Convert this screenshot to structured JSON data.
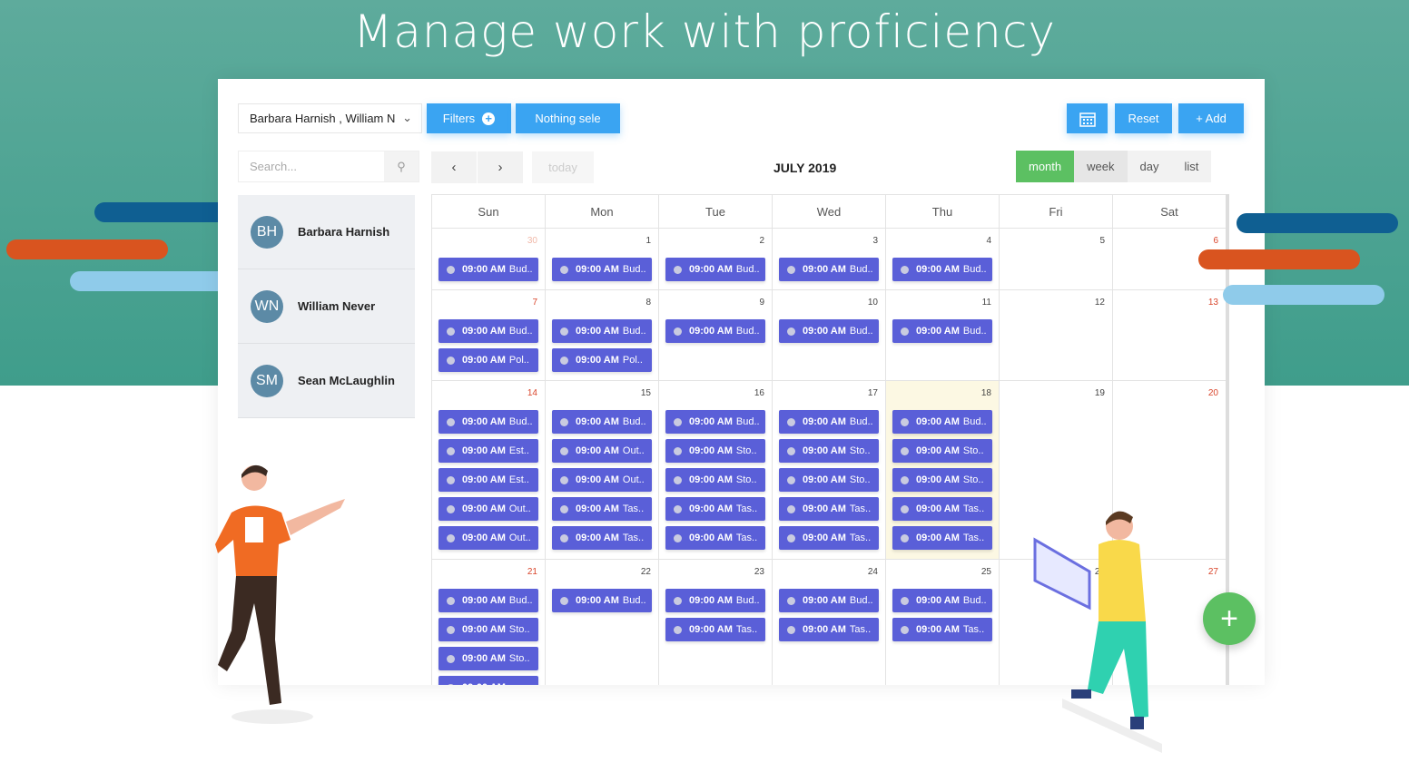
{
  "headline": "Manage work with proficiency",
  "colors": {
    "teal": "#4fa595",
    "event": "#5a5fd8",
    "primary": "#3aa4f2",
    "active_view": "#5cc062",
    "stripe_blue": "#0f5f92",
    "stripe_orange": "#d9541f",
    "stripe_light": "#8fcbea"
  },
  "toolbar": {
    "resource_select": "Barbara Harnish , William N",
    "filters": "Filters",
    "nothing_selected": "Nothing sele",
    "calendar_icon": "calendar-icon",
    "reset": "Reset",
    "add": "+ Add"
  },
  "search": {
    "placeholder": "Search..."
  },
  "nav": {
    "prev": "‹",
    "next": "›",
    "today": "today"
  },
  "calendar": {
    "title": "JULY 2019",
    "views": [
      "month",
      "week",
      "day",
      "list"
    ],
    "active_view": "month",
    "weekdays": [
      "Sun",
      "Mon",
      "Tue",
      "Wed",
      "Thu",
      "Fri",
      "Sat"
    ],
    "today": 18,
    "event_time": "09:00 AM",
    "weeks": [
      [
        {
          "n": "30",
          "other": true,
          "ev": [
            "Bud.."
          ]
        },
        {
          "n": "1",
          "ev": [
            "Bud.."
          ]
        },
        {
          "n": "2",
          "ev": [
            "Bud.."
          ]
        },
        {
          "n": "3",
          "ev": [
            "Bud.."
          ]
        },
        {
          "n": "4",
          "ev": [
            "Bud.."
          ]
        },
        {
          "n": "5",
          "ev": []
        },
        {
          "n": "6",
          "ev": []
        }
      ],
      [
        {
          "n": "7",
          "ev": [
            "Bud..",
            "Pol.."
          ]
        },
        {
          "n": "8",
          "ev": [
            "Bud..",
            "Pol.."
          ]
        },
        {
          "n": "9",
          "ev": [
            "Bud.."
          ]
        },
        {
          "n": "10",
          "ev": [
            "Bud.."
          ]
        },
        {
          "n": "11",
          "ev": [
            "Bud.."
          ]
        },
        {
          "n": "12",
          "ev": []
        },
        {
          "n": "13",
          "ev": []
        }
      ],
      [
        {
          "n": "14",
          "ev": [
            "Bud..",
            "Est..",
            "Est..",
            "Out..",
            "Out.."
          ]
        },
        {
          "n": "15",
          "ev": [
            "Bud..",
            "Out..",
            "Out..",
            "Tas..",
            "Tas.."
          ]
        },
        {
          "n": "16",
          "ev": [
            "Bud..",
            "Sto..",
            "Sto..",
            "Tas..",
            "Tas.."
          ]
        },
        {
          "n": "17",
          "ev": [
            "Bud..",
            "Sto..",
            "Sto..",
            "Tas..",
            "Tas.."
          ]
        },
        {
          "n": "18",
          "ev": [
            "Bud..",
            "Sto..",
            "Sto..",
            "Tas..",
            "Tas.."
          ]
        },
        {
          "n": "19",
          "ev": []
        },
        {
          "n": "20",
          "ev": []
        }
      ],
      [
        {
          "n": "21",
          "ev": [
            "Bud..",
            "Sto..",
            "Sto..",
            ""
          ]
        },
        {
          "n": "22",
          "ev": [
            "Bud.."
          ]
        },
        {
          "n": "23",
          "ev": [
            "Bud..",
            "Tas.."
          ]
        },
        {
          "n": "24",
          "ev": [
            "Bud..",
            "Tas.."
          ]
        },
        {
          "n": "25",
          "ev": [
            "Bud..",
            "Tas.."
          ]
        },
        {
          "n": "26",
          "ev": []
        },
        {
          "n": "27",
          "ev": []
        }
      ]
    ]
  },
  "people": [
    {
      "initials": "BH",
      "name": "Barbara Harnish"
    },
    {
      "initials": "WN",
      "name": "William Never"
    },
    {
      "initials": "SM",
      "name": "Sean McLaughlin"
    }
  ],
  "fab": "+"
}
